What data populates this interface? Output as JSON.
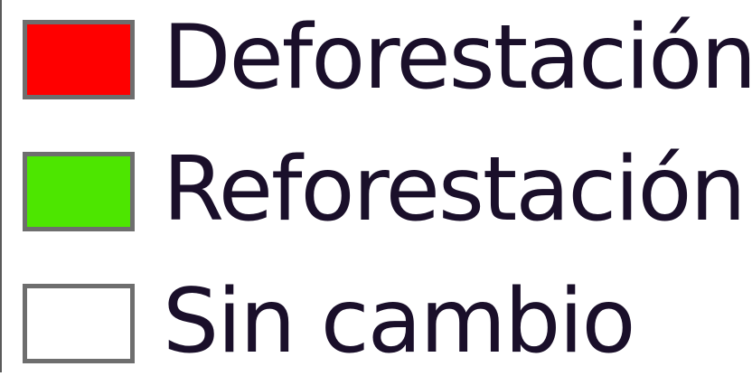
{
  "legend": {
    "items": [
      {
        "label": "Deforestación",
        "color": "#ff0000"
      },
      {
        "label": "Reforestación",
        "color": "#4de600"
      },
      {
        "label": "Sin cambio",
        "color": "#ffffff"
      }
    ],
    "swatch_border_color": "#6e6e6e"
  }
}
